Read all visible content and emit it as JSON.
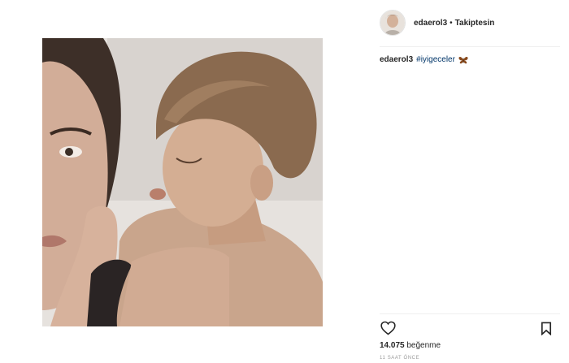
{
  "post": {
    "author": {
      "username": "edaerol3",
      "separator": "•",
      "follow_status": "Takiptesin"
    },
    "caption": {
      "username": "edaerol3",
      "hashtag": "#iyigeceler",
      "emoji": "butterfly-icon"
    },
    "likes": {
      "count": "14.075",
      "label": "beğenme"
    },
    "time": "11 SAAT ÖNCE",
    "icons": {
      "like": "heart-icon",
      "save": "bookmark-icon"
    },
    "colors": {
      "hashtag": "#003569",
      "text": "#262626",
      "muted": "#999999"
    }
  }
}
